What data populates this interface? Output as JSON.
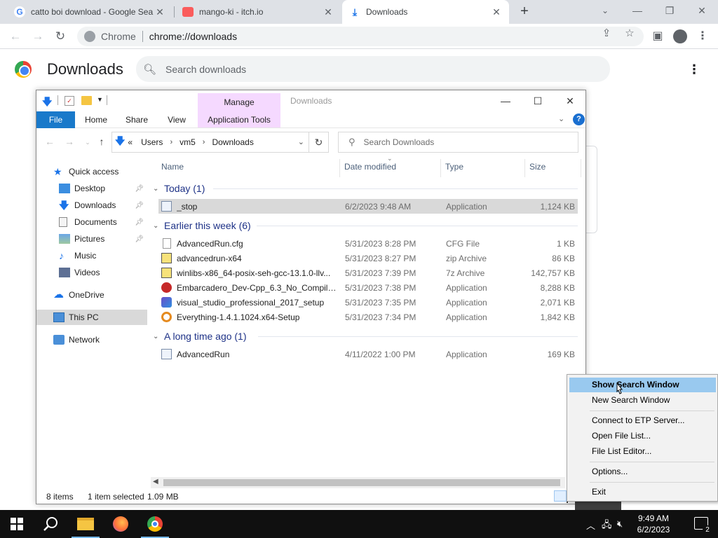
{
  "browser": {
    "tabs": [
      {
        "title": "catto boi download - Google Sea",
        "icon": "google-icon",
        "active": false
      },
      {
        "title": "mango-ki - itch.io",
        "icon": "itch-icon",
        "active": false
      },
      {
        "title": "Downloads",
        "icon": "download-icon",
        "active": true
      }
    ],
    "new_tab_symbol": "+",
    "omnibox": {
      "chip": "Chrome",
      "url": "chrome://downloads"
    }
  },
  "downloads_page": {
    "title": "Downloads",
    "search_placeholder": "Search downloads"
  },
  "explorer": {
    "contextual_tab": "Manage",
    "window_title": "Downloads",
    "ribbon_tabs": [
      "File",
      "Home",
      "Share",
      "View",
      "Application Tools"
    ],
    "address": {
      "overflow": "«",
      "segments": [
        "Users",
        "vm5",
        "Downloads"
      ]
    },
    "search_placeholder": "Search Downloads",
    "nav_items": [
      {
        "label": "Quick access",
        "icon": "star-icon",
        "pinned": false
      },
      {
        "label": "Desktop",
        "icon": "desktop-folder-icon",
        "pinned": true
      },
      {
        "label": "Downloads",
        "icon": "downloads-folder-icon",
        "pinned": true
      },
      {
        "label": "Documents",
        "icon": "documents-folder-icon",
        "pinned": true
      },
      {
        "label": "Pictures",
        "icon": "pictures-folder-icon",
        "pinned": true
      },
      {
        "label": "Music",
        "icon": "music-folder-icon",
        "pinned": false
      },
      {
        "label": "Videos",
        "icon": "videos-folder-icon",
        "pinned": false
      },
      {
        "label": "OneDrive",
        "icon": "onedrive-icon",
        "pinned": false
      },
      {
        "label": "This PC",
        "icon": "this-pc-icon",
        "pinned": false,
        "selected": true
      },
      {
        "label": "Network",
        "icon": "network-icon",
        "pinned": false
      }
    ],
    "columns": {
      "name": "Name",
      "date": "Date modified",
      "type": "Type",
      "size": "Size"
    },
    "groups": [
      {
        "label": "Today (1)",
        "files": [
          {
            "name": "_stop",
            "date": "6/2/2023 9:48 AM",
            "type": "Application",
            "size": "1,124 KB",
            "icon": "application-icon",
            "selected": true
          }
        ]
      },
      {
        "label": "Earlier this week (6)",
        "files": [
          {
            "name": "AdvancedRun.cfg",
            "date": "5/31/2023 8:28 PM",
            "type": "CFG File",
            "size": "1 KB",
            "icon": "file-icon"
          },
          {
            "name": "advancedrun-x64",
            "date": "5/31/2023 8:27 PM",
            "type": "zip Archive",
            "size": "86 KB",
            "icon": "zip-archive-icon"
          },
          {
            "name": "winlibs-x86_64-posix-seh-gcc-13.1.0-llv...",
            "date": "5/31/2023 7:39 PM",
            "type": "7z Archive",
            "size": "142,757 KB",
            "icon": "7z-archive-icon"
          },
          {
            "name": "Embarcadero_Dev-Cpp_6.3_No_Compiler...",
            "date": "5/31/2023 7:38 PM",
            "type": "Application",
            "size": "8,288 KB",
            "icon": "devcpp-icon"
          },
          {
            "name": "visual_studio_professional_2017_setup",
            "date": "5/31/2023 7:35 PM",
            "type": "Application",
            "size": "2,071 KB",
            "icon": "visual-studio-icon"
          },
          {
            "name": "Everything-1.4.1.1024.x64-Setup",
            "date": "5/31/2023 7:34 PM",
            "type": "Application",
            "size": "1,842 KB",
            "icon": "everything-search-icon"
          }
        ]
      },
      {
        "label": "A long time ago (1)",
        "files": [
          {
            "name": "AdvancedRun",
            "date": "4/11/2022 1:00 PM",
            "type": "Application",
            "size": "169 KB",
            "icon": "application-icon"
          }
        ]
      }
    ],
    "status": {
      "items": "8 items",
      "selected": "1 item selected",
      "size": "1.09 MB"
    }
  },
  "context_menu": {
    "items": [
      {
        "label": "Show Search Window",
        "highlighted": true
      },
      {
        "label": "New Search Window"
      },
      {
        "label": "Connect to ETP Server..."
      },
      {
        "label": "Open File List..."
      },
      {
        "label": "File List Editor..."
      },
      {
        "label": "Options..."
      },
      {
        "label": "Exit"
      }
    ]
  },
  "taskbar": {
    "apps": [
      "start-icon",
      "search-icon",
      "file-explorer-icon",
      "firefox-icon",
      "chrome-icon"
    ],
    "time": "9:49 AM",
    "date": "6/2/2023",
    "notification_count": "2"
  },
  "colors": {
    "chrome_tabstrip": "#dee1e6",
    "explorer_file_tab": "#1979ca",
    "manage_tab": "#f5d9ff",
    "context_highlight": "#99c9ef",
    "taskbar": "#101010"
  }
}
